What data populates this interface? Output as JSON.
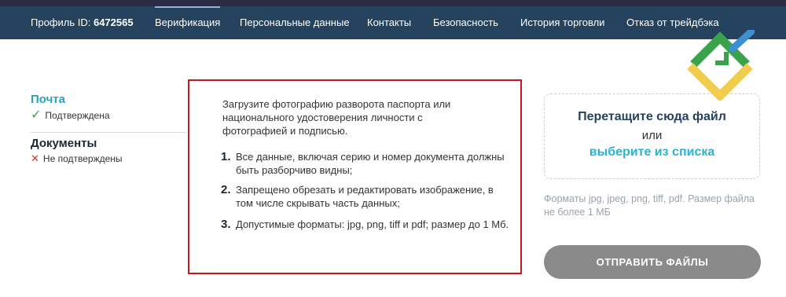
{
  "header": {
    "profile_prefix": "Профиль ID: ",
    "profile_id": "6472565",
    "tabs": [
      {
        "label": "Верификация",
        "active": true
      },
      {
        "label": "Персональные данные"
      },
      {
        "label": "Контакты"
      },
      {
        "label": "Безопасность"
      },
      {
        "label": "История торговли"
      },
      {
        "label": "Отказ от трейдбэка"
      }
    ]
  },
  "sidebar": {
    "mail": {
      "title": "Почта",
      "status": "Подтверждена",
      "status_icon": "check-icon"
    },
    "documents": {
      "title": "Документы",
      "status": "Не подтверждены",
      "status_icon": "cross-icon"
    }
  },
  "instructions": {
    "intro": "Загрузите фотографию разворота паспорта или национального удостоверения личности с фотографией и подписью.",
    "rules": [
      {
        "num": "1.",
        "text": "Все данные, включая серию и номер документа должны быть разборчиво видны;"
      },
      {
        "num": "2.",
        "text": "Запрещено обрезать и редактировать изображение, в том числе скрывать часть данных;"
      },
      {
        "num": "3.",
        "text": "Допустимые форматы: jpg, png, tiff и pdf; размер до 1 Мб."
      }
    ]
  },
  "upload": {
    "drop_title": "Перетащите сюда файл",
    "or": "или",
    "choose_link": "выберите из списка",
    "formats_note": "Форматы jpg, jpeg, png, tiff, pdf. Размер файла не более 1 МБ",
    "send_button": "ОТПРАВИТЬ ФАЙЛЫ"
  },
  "colors": {
    "header_bg": "#25425f",
    "accent": "#2ab3d1",
    "highlight_border": "#c9161c",
    "button_bg": "#8a8a8a",
    "logo_green": "#3aa24a",
    "logo_blue": "#3d8fd1",
    "logo_yellow": "#f2cc4d"
  }
}
